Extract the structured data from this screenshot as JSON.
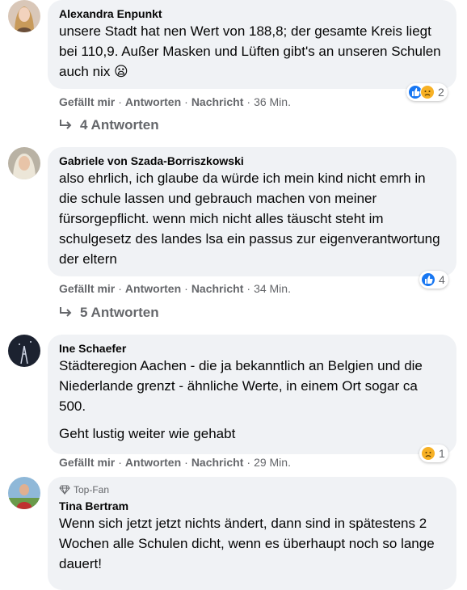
{
  "comments": [
    {
      "author": "Alexandra Enpunkt",
      "lines": [
        "unsere Stadt hat nen Wert von 188,8; der gesamte Kreis liegt bei 110,9. Außer Masken und Lüften gibt's an unseren Schulen auch nix 😦"
      ],
      "like": "Gefällt mir",
      "reply": "Antworten",
      "message": "Nachricht",
      "time": "36 Min.",
      "reaction_count": "2",
      "reactions": [
        "like",
        "sad"
      ],
      "replies_label": "4 Antworten"
    },
    {
      "author": "Gabriele von Szada-Borriszkowski",
      "lines": [
        "also ehrlich, ich glaube da würde ich mein kind nicht emrh in die schule lassen und gebrauch machen von meiner fürsorgepflicht. wenn mich nicht alles täuscht steht im schulgesetz des landes lsa ein passus zur eigenverantwortung der eltern"
      ],
      "like": "Gefällt mir",
      "reply": "Antworten",
      "message": "Nachricht",
      "time": "34 Min.",
      "reaction_count": "4",
      "reactions": [
        "like"
      ],
      "replies_label": "5 Antworten"
    },
    {
      "author": "Ine Schaefer",
      "lines": [
        "Städteregion Aachen - die ja bekanntlich an Belgien und die Niederlande grenzt - ähnliche Werte, in einem Ort sogar ca 500.",
        "Geht lustig weiter wie gehabt"
      ],
      "like": "Gefällt mir",
      "reply": "Antworten",
      "message": "Nachricht",
      "time": "29 Min.",
      "reaction_count": "1",
      "reactions": [
        "sad"
      ]
    },
    {
      "badge": "Top-Fan",
      "author": "Tina Bertram",
      "lines": [
        "Wenn sich jetzt jetzt nichts ändert, dann sind in spätestens 2 Wochen alle Schulen dicht, wenn es überhaupt noch so lange dauert!"
      ]
    }
  ],
  "colors": {
    "bubble": "#f0f2f5",
    "meta": "#65676b",
    "like_blue": "#1877f2",
    "sad_yellow": "#f7b125"
  }
}
